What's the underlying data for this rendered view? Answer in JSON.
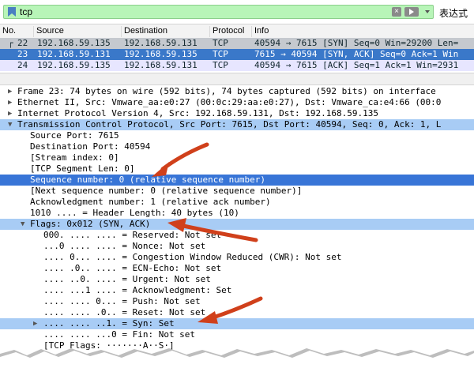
{
  "filter": {
    "value": "tcp",
    "expression_label": "表达式"
  },
  "packet_list": {
    "columns": [
      "No.",
      "Source",
      "Destination",
      "Protocol",
      "Info"
    ],
    "rows": [
      {
        "no": "22",
        "marker": "┌",
        "source": "192.168.59.135",
        "destination": "192.168.59.131",
        "protocol": "TCP",
        "info": "40594 → 7615 [SYN] Seq=0 Win=29200 Len="
      },
      {
        "no": "23",
        "marker": "",
        "source": "192.168.59.131",
        "destination": "192.168.59.135",
        "protocol": "TCP",
        "info": "7615 → 40594 [SYN, ACK] Seq=0 Ack=1 Win"
      },
      {
        "no": "24",
        "marker": "",
        "source": "192.168.59.135",
        "destination": "192.168.59.131",
        "protocol": "TCP",
        "info": "40594 → 7615 [ACK] Seq=1 Ack=1 Win=2931"
      }
    ]
  },
  "details": [
    "Frame 23: 74 bytes on wire (592 bits), 74 bytes captured (592 bits) on interface",
    "Ethernet II, Src: Vmware_aa:e0:27 (00:0c:29:aa:e0:27), Dst: Vmware_ca:e4:66 (00:0",
    "Internet Protocol Version 4, Src: 192.168.59.131, Dst: 192.168.59.135",
    "Transmission Control Protocol, Src Port: 7615, Dst Port: 40594, Seq: 0, Ack: 1, L",
    "Source Port: 7615",
    "Destination Port: 40594",
    "[Stream index: 0]",
    "[TCP Segment Len: 0]",
    "Sequence number: 0    (relative sequence number)",
    "[Next sequence number: 0    (relative sequence number)]",
    "Acknowledgment number: 1    (relative ack number)",
    "1010 .... = Header Length: 40 bytes (10)",
    "Flags: 0x012 (SYN, ACK)",
    "000. .... .... = Reserved: Not set",
    "...0 .... .... = Nonce: Not set",
    ".... 0... .... = Congestion Window Reduced (CWR): Not set",
    ".... .0.. .... = ECN-Echo: Not set",
    ".... ..0. .... = Urgent: Not set",
    ".... ...1 .... = Acknowledgment: Set",
    ".... .... 0... = Push: Not set",
    ".... .... .0.. = Reset: Not set",
    ".... .... ..1. = Syn: Set",
    ".... .... ...0 = Fin: Not set",
    "[TCP Flags: ·······A··S·]"
  ],
  "colors": {
    "selected_row": "#3a78c9",
    "annotation_arrow": "#d0401b",
    "filter_valid": "#b8f5b8"
  }
}
